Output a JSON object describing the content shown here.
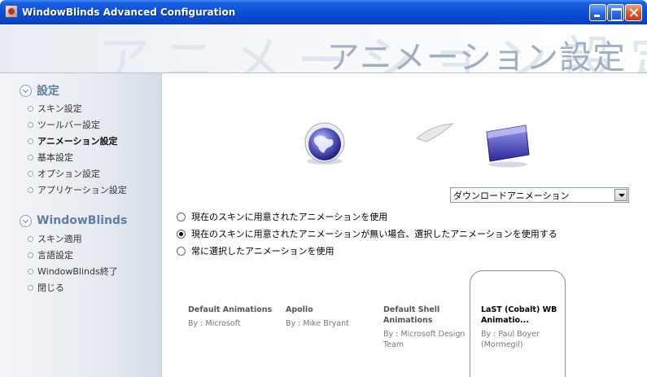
{
  "window": {
    "title": "WindowBlinds Advanced Configuration"
  },
  "header": {
    "watermark": "アニメーション設定",
    "page_title": "アニメーション設定"
  },
  "sidebar": {
    "sections": [
      {
        "title": "設定",
        "items": [
          {
            "label": "スキン設定",
            "active": false
          },
          {
            "label": "ツールバー設定",
            "active": false
          },
          {
            "label": "アニメーション設定",
            "active": true
          },
          {
            "label": "基本設定",
            "active": false
          },
          {
            "label": "オプション設定",
            "active": false
          },
          {
            "label": "アプリケーション設定",
            "active": false
          }
        ]
      },
      {
        "title": "WindowBlinds",
        "items": [
          {
            "label": "スキン適用"
          },
          {
            "label": "言語設定"
          },
          {
            "label": "WindowBlinds終了"
          },
          {
            "label": "閉じる"
          }
        ]
      }
    ]
  },
  "main": {
    "animation_select": {
      "value": "ダウンロードアニメーション"
    },
    "radio_options": [
      {
        "label": "現在のスキンに用意されたアニメーションを使用",
        "checked": false
      },
      {
        "label": "現在のスキンに用意されたアニメーションが無い場合、選択したアニメーションを使用する",
        "checked": true
      },
      {
        "label": "常に選択したアニメーションを使用",
        "checked": false
      }
    ],
    "animations": [
      {
        "name": "Default Animations",
        "author": "By : Microsoft",
        "selected": false
      },
      {
        "name": "Apollo",
        "author": "By : Mike Bryant",
        "selected": false
      },
      {
        "name": "Default Shell Animations",
        "author": "By : Microsoft Design Team",
        "selected": false
      },
      {
        "name": "LaST (Cobalt) WB Animatio...",
        "author": "By : Paul Boyer (Mormegil)",
        "selected": true
      }
    ]
  },
  "colors": {
    "titlebar": "#0a4fd8",
    "sidebar_heading": "#5f7da0",
    "page_title": "#9fb0c4"
  },
  "icons": {
    "preview_source": "globe-icon",
    "preview_arrow": "swoosh-arrow-icon",
    "preview_target": "folder-window-icon"
  }
}
